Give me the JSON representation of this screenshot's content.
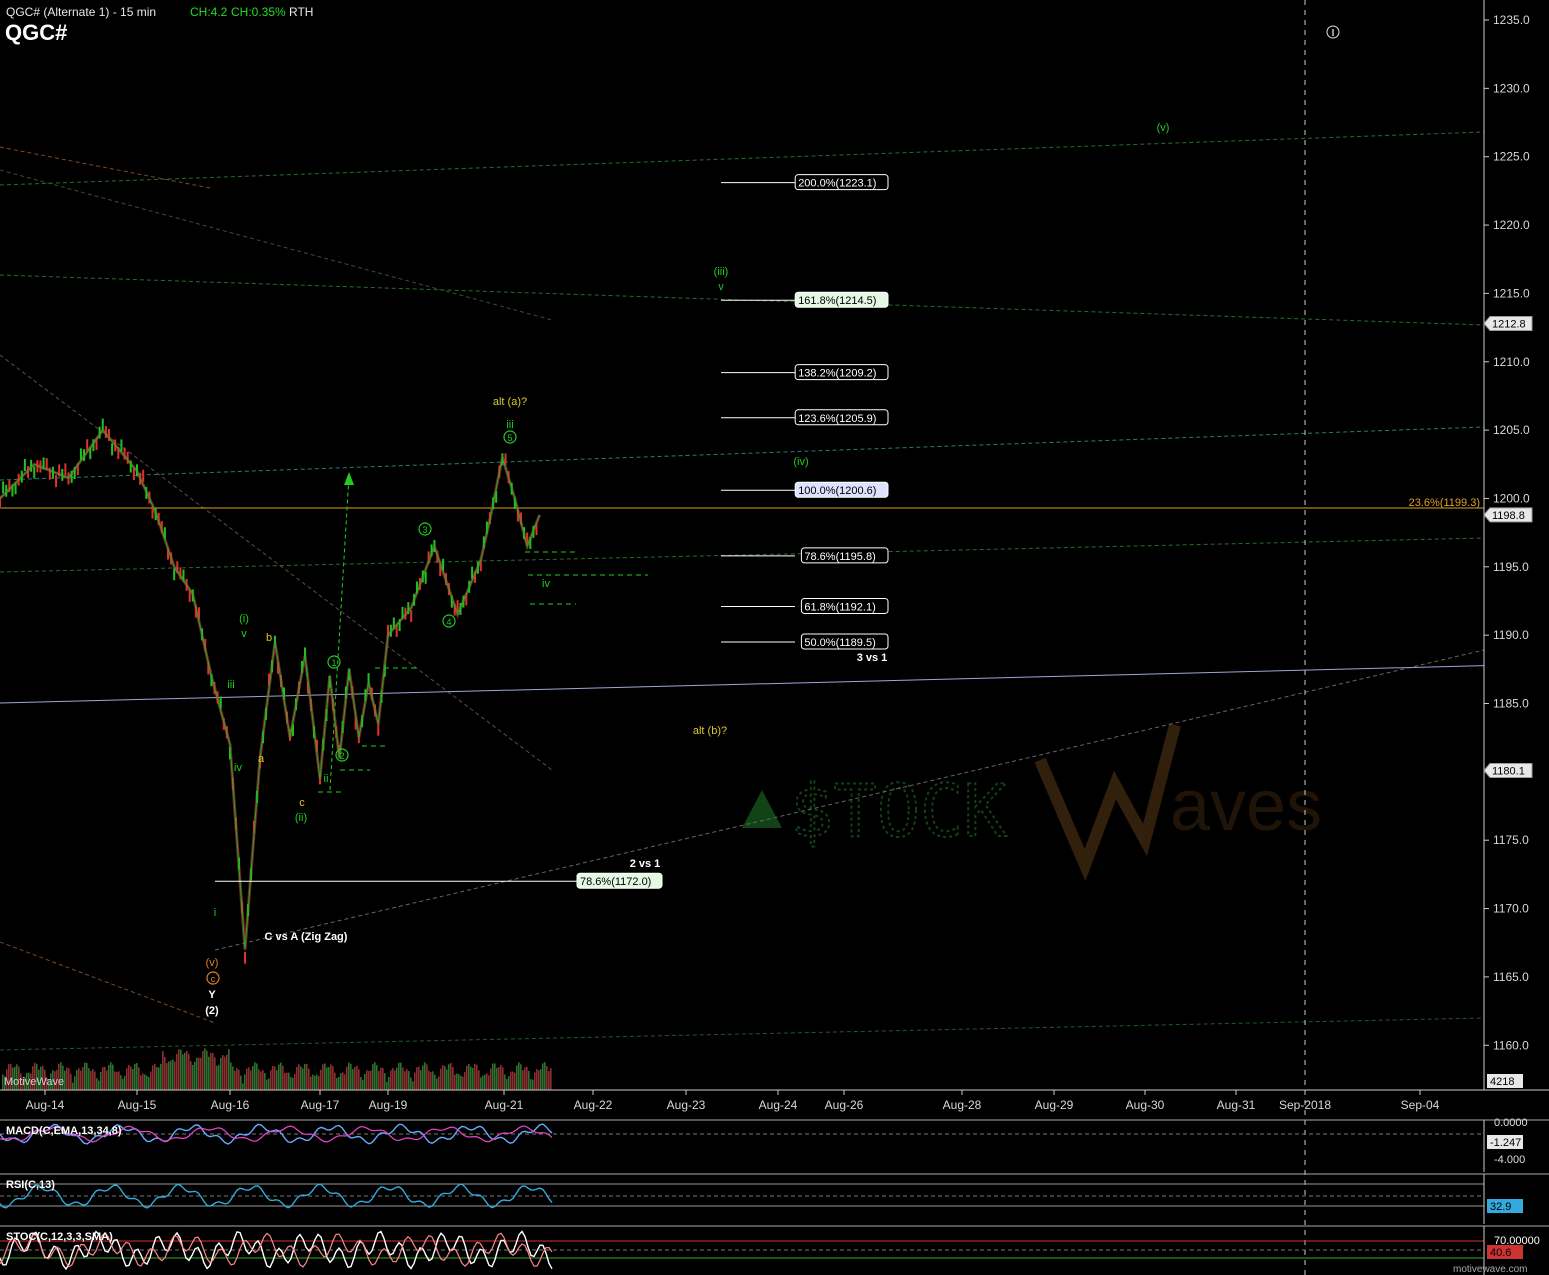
{
  "header": {
    "symbol_line": "QGC# (Alternate 1) - 15 min",
    "change_pts": "CH:4.2",
    "change_pct": "CH:0.35%",
    "session": "RTH",
    "big_symbol": "QGC#"
  },
  "info_icon": "info-icon",
  "colors": {
    "background": "#000000",
    "up_bar": "#22c022",
    "down_bar": "#e03030",
    "fib_orange": "#e0a020",
    "wave_green": "#22cc22",
    "wave_yellow": "#d8c830",
    "wave_orange": "#e08020",
    "blue_trend": "#8899cc"
  },
  "chart_data": [
    {
      "type": "line",
      "title": "QGC# (Alternate 1) - 15 min",
      "x_ticks": [
        "Aug-14",
        "Aug-15",
        "Aug-16",
        "Aug-17",
        "Aug-19",
        "Aug-21",
        "Aug-22",
        "Aug-23",
        "Aug-24",
        "Aug-26",
        "Aug-28",
        "Aug-29",
        "Aug-30",
        "Aug-31",
        "Sep-2018",
        "Sep-04"
      ],
      "ylim": [
        1157.5,
        1236.5
      ],
      "y_ticks": [
        1235.0,
        1230.0,
        1225.0,
        1220.0,
        1215.0,
        1210.0,
        1205.0,
        1200.0,
        1195.0,
        1190.0,
        1185.0,
        1180.0,
        1175.0,
        1170.0,
        1165.0,
        1160.0
      ],
      "y_tick_labels": [
        "1235.0",
        "1230.0",
        "1225.0",
        "1220.0",
        "1215.0",
        "1210.0",
        "1205.0",
        "1200.0",
        "1195.0",
        "1190.0",
        "1185.0",
        "1180.0",
        "1175.0",
        "1170.0",
        "1165.0",
        "1160.0"
      ],
      "price_flags": [
        "1212.8",
        "1198.8",
        "1180.1"
      ],
      "volume_flag": "4218",
      "price_path": [
        [
          "Aug-14",
          1200.0
        ],
        [
          "Aug-14",
          1202.5
        ],
        [
          "Aug-14",
          1201.5
        ],
        [
          "Aug-14",
          1205.0
        ],
        [
          "Aug-15",
          1202.0
        ],
        [
          "Aug-15",
          1199.0
        ],
        [
          "Aug-15",
          1195.0
        ],
        [
          "Aug-15",
          1193.0
        ],
        [
          "Aug-15",
          1187.0
        ],
        [
          "Aug-16",
          1182.0
        ],
        [
          "Aug-16",
          1167.0
        ],
        [
          "Aug-16",
          1181.0
        ],
        [
          "Aug-16",
          1189.5
        ],
        [
          "Aug-16",
          1182.5
        ],
        [
          "Aug-16",
          1188.5
        ],
        [
          "Aug-17",
          1179.5
        ],
        [
          "Aug-17",
          1187.0
        ],
        [
          "Aug-17",
          1181.0
        ],
        [
          "Aug-17",
          1187.5
        ],
        [
          "Aug-17",
          1182.5
        ],
        [
          "Aug-17",
          1186.5
        ],
        [
          "Aug-17",
          1183.5
        ],
        [
          "Aug-19",
          1190.0
        ],
        [
          "Aug-19",
          1192.0
        ],
        [
          "Aug-19",
          1196.5
        ],
        [
          "Aug-19",
          1191.5
        ],
        [
          "Aug-19",
          1195.5
        ],
        [
          "Aug-21",
          1198.5
        ],
        [
          "Aug-21",
          1203.0
        ],
        [
          "Aug-21",
          1200.0
        ],
        [
          "Aug-21",
          1196.5
        ],
        [
          "Aug-21",
          1198.8
        ]
      ],
      "fib_levels": [
        {
          "label": "200.0%(1223.1)",
          "value": 1223.1
        },
        {
          "label": "161.8%(1214.5)",
          "value": 1214.5
        },
        {
          "label": "138.2%(1209.2)",
          "value": 1209.2
        },
        {
          "label": "123.6%(1205.9)",
          "value": 1205.9
        },
        {
          "label": "100.0%(1200.6)",
          "value": 1200.6
        },
        {
          "label": "78.6%(1195.8)",
          "value": 1195.8
        },
        {
          "label": "61.8%(1192.1)",
          "value": 1192.1
        },
        {
          "label": "50.0%(1189.5)",
          "value": 1189.5
        }
      ],
      "fib_lower": {
        "label": "78.6%(1172.0)",
        "value": 1172.0
      },
      "fib_horizontal": {
        "label": "23.6%(1199.3)",
        "value": 1199.3
      },
      "annotations": [
        {
          "text": "alt (a)?",
          "color": "yellow"
        },
        {
          "text": "iii",
          "color": "green"
        },
        {
          "text": "5",
          "color": "green",
          "circled": true
        },
        {
          "text": "(iii)",
          "color": "green"
        },
        {
          "text": "v",
          "color": "green"
        },
        {
          "text": "(v)",
          "color": "green"
        },
        {
          "text": "(iv)",
          "color": "green"
        },
        {
          "text": "3",
          "color": "green",
          "circled": true
        },
        {
          "text": "4",
          "color": "green",
          "circled": true
        },
        {
          "text": "iv",
          "color": "green"
        },
        {
          "text": "3 vs 1",
          "color": "white"
        },
        {
          "text": "alt (b)?",
          "color": "yellow"
        },
        {
          "text": "(i)",
          "color": "green"
        },
        {
          "text": "v",
          "color": "green"
        },
        {
          "text": "b",
          "color": "yellow"
        },
        {
          "text": "iii",
          "color": "green"
        },
        {
          "text": "a",
          "color": "yellow"
        },
        {
          "text": "iv",
          "color": "green"
        },
        {
          "text": "i",
          "color": "green"
        },
        {
          "text": "1",
          "color": "green",
          "circled": true
        },
        {
          "text": "2",
          "color": "green",
          "circled": true
        },
        {
          "text": "ii",
          "color": "green"
        },
        {
          "text": "c",
          "color": "yellow"
        },
        {
          "text": "(ii)",
          "color": "green"
        },
        {
          "text": "2 vs 1",
          "color": "white"
        },
        {
          "text": "i",
          "color": "green"
        },
        {
          "text": "C vs A (Zig Zag)",
          "color": "white"
        },
        {
          "text": "(v)",
          "color": "orange"
        },
        {
          "text": "c",
          "color": "orange",
          "circled": true
        },
        {
          "text": "Y",
          "color": "white"
        },
        {
          "text": "(2)",
          "color": "white"
        }
      ]
    },
    {
      "type": "line",
      "title": "MACD(C,EMA,13,34,8)",
      "y_tick_labels": [
        "0.0000",
        "-4.000"
      ],
      "last_value": "-1.247"
    },
    {
      "type": "line",
      "title": "RSI(C,13)",
      "last_value": "32.9"
    },
    {
      "type": "line",
      "title": "STOC(C,12,3,3,SMA)",
      "y_tick_labels": [
        "70.00000"
      ],
      "last_value": "40.6"
    }
  ],
  "watermark": {
    "left": "$TOCK",
    "right": "aves"
  },
  "volume_label": "MotiveWave",
  "footer": "motivewave.com"
}
